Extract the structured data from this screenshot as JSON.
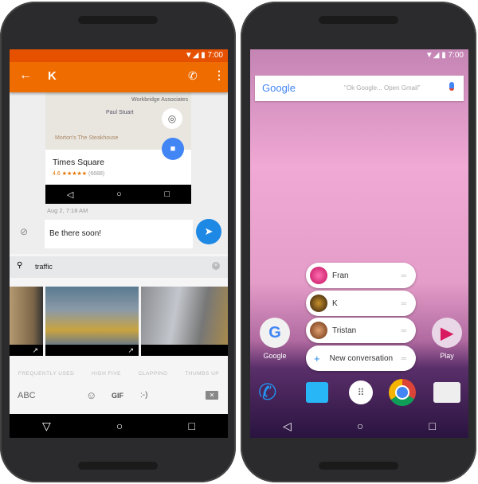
{
  "status": {
    "time": "7:00"
  },
  "messenger": {
    "contact": "K",
    "map": {
      "labels": [
        "Workbridge Associates",
        "Paul Stuart",
        "Morton's The Steakhouse"
      ]
    },
    "place": {
      "name": "Times Square",
      "rating": "4.6",
      "stars": "★★★★★",
      "reviews": "(6688)"
    },
    "timestamp": "Aug 2, 7:18 AM",
    "draft": "Be there soon!",
    "gif_search": "traffic",
    "categories": [
      "FREQUENTLY USED",
      "HIGH FIVE",
      "CLAPPING",
      "THUMBS UP"
    ],
    "keys": {
      "abc": "ABC",
      "gif": "GIF",
      "emoticon": ":-)"
    },
    "accent": "#ef6c00",
    "send_color": "#1e88e5"
  },
  "launcher": {
    "search_logo": "Google",
    "search_hint": "\"Ok Google... Open Gmail\"",
    "shortcuts": [
      "Fran",
      "K",
      "Tristan",
      "New conversation"
    ],
    "apps": [
      {
        "label": "Google"
      },
      {
        "label": "Play"
      }
    ]
  }
}
